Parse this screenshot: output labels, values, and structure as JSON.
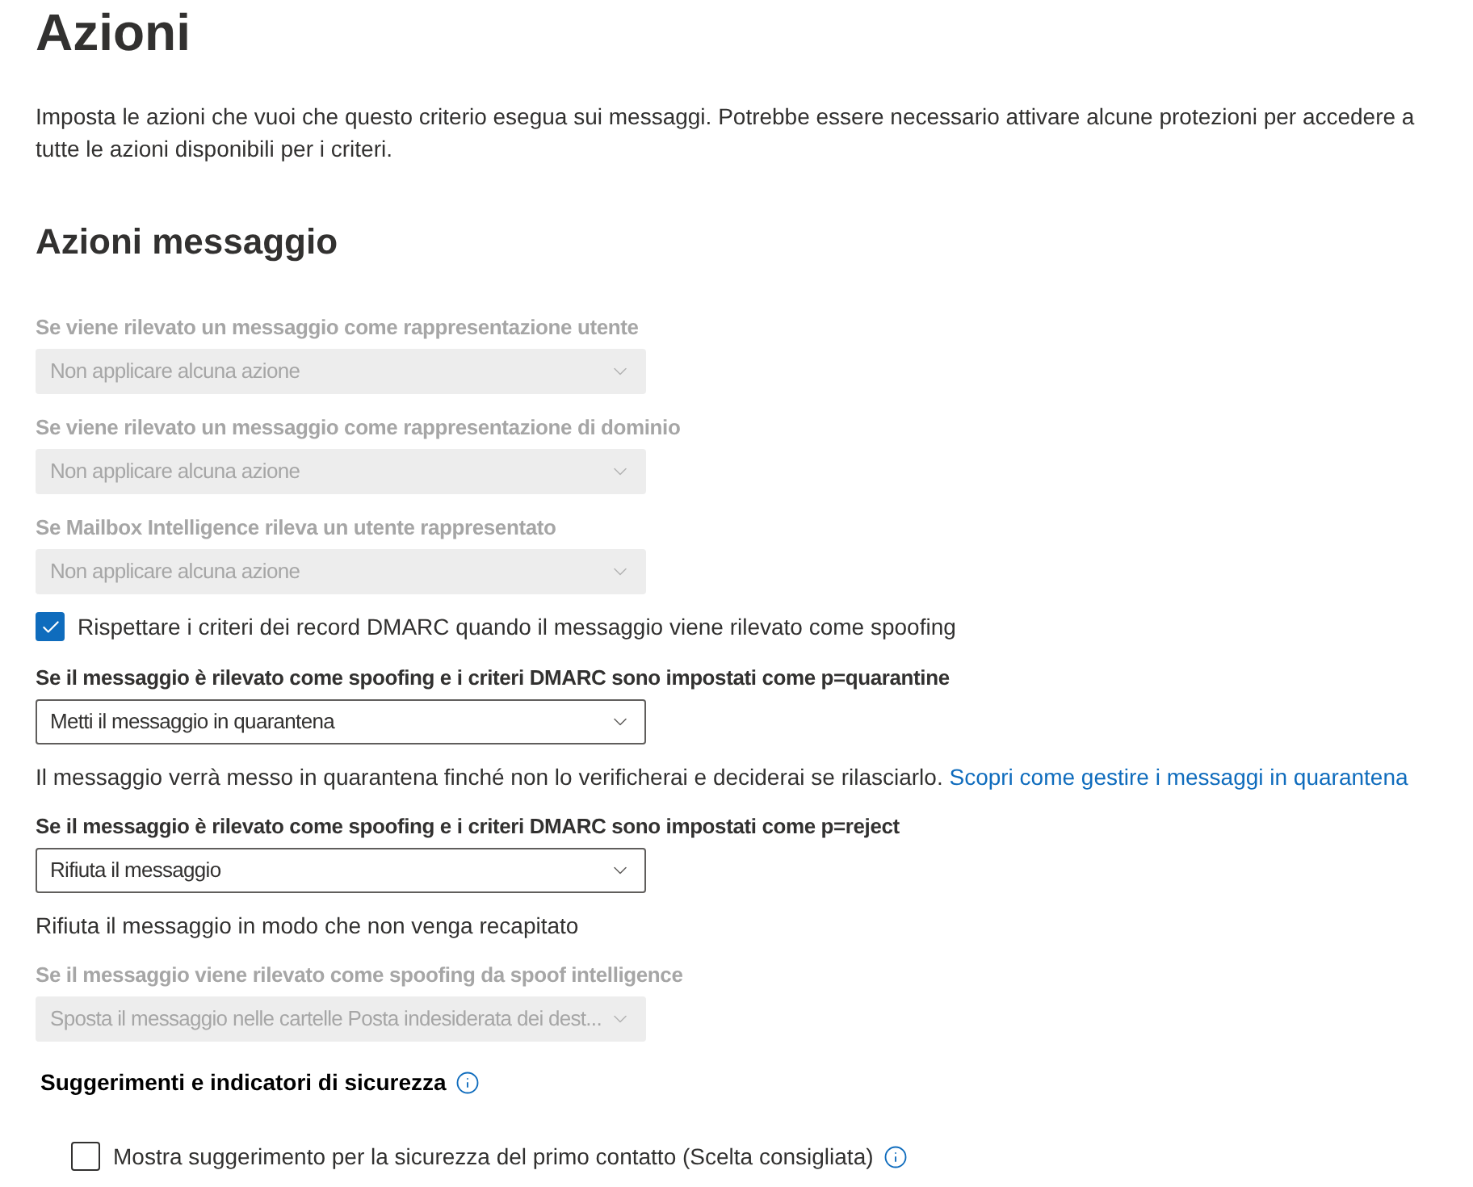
{
  "page": {
    "title": "Azioni",
    "description": "Imposta le azioni che vuoi che questo criterio esegua sui messaggi. Potrebbe essere necessario attivare alcune protezioni per accedere a tutte le azioni disponibili per i criteri."
  },
  "message_actions": {
    "title": "Azioni messaggio",
    "items": [
      {
        "kind": "dropdown",
        "label": "Se viene rilevato un messaggio come rappresentazione utente",
        "value": "Non applicare alcuna azione",
        "disabled": true
      },
      {
        "kind": "dropdown",
        "label": "Se viene rilevato un messaggio come rappresentazione di dominio",
        "value": "Non applicare alcuna azione",
        "disabled": true
      },
      {
        "kind": "dropdown",
        "label": "Se Mailbox Intelligence rileva un utente rappresentato",
        "value": "Non applicare alcuna azione",
        "disabled": true
      },
      {
        "kind": "checkbox",
        "label": "Rispettare i criteri dei record DMARC quando il messaggio viene rilevato come spoofing",
        "checked": true
      },
      {
        "kind": "dropdown",
        "label": "Se il messaggio è rilevato come spoofing e i criteri DMARC sono impostati come p=quarantine",
        "value": "Metti il messaggio in quarantena",
        "disabled": false,
        "help": {
          "text": "Il messaggio verrà messo in quarantena finché non lo verificherai e deciderai se rilasciarlo.",
          "link": "Scopri come gestire i messaggi in quarantena"
        }
      },
      {
        "kind": "dropdown",
        "label": "Se il messaggio è rilevato come spoofing e i criteri DMARC sono impostati come p=reject",
        "value": "Rifiuta il messaggio",
        "disabled": false,
        "help": {
          "text": "Rifiuta il messaggio in modo che non venga recapitato"
        }
      },
      {
        "kind": "dropdown",
        "label": "Se il messaggio viene rilevato come spoofing da spoof intelligence",
        "value": "Sposta il messaggio nelle cartelle Posta indesiderata dei dest...",
        "disabled": true
      }
    ]
  },
  "safety_tips": {
    "title": "Suggerimenti e indicatori di sicurezza",
    "items": [
      {
        "label": "Mostra suggerimento per la sicurezza del primo contatto (Scelta consigliata)",
        "checked": false
      }
    ]
  }
}
